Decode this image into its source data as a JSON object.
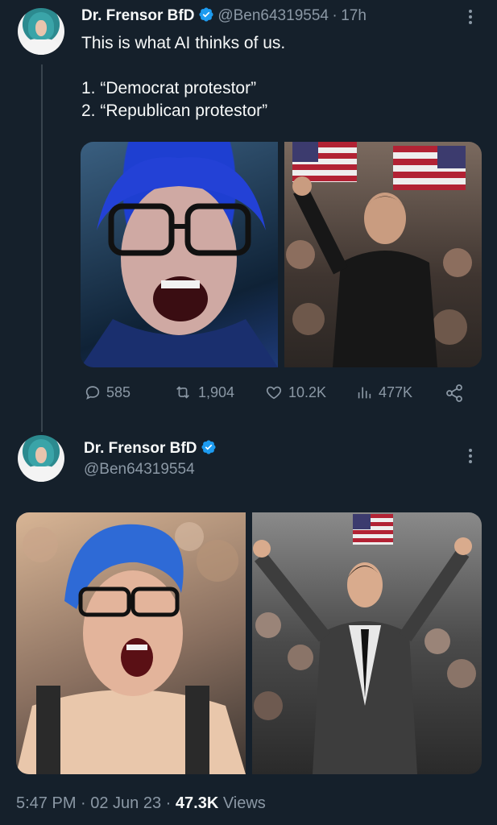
{
  "tweet1": {
    "author_name": "Dr. Frensor BfD",
    "handle": "@Ben64319554",
    "separator": "·",
    "time": "17h",
    "text_line1": "This is what AI thinks of us.",
    "text_line2": "1. “Democrat protestor”",
    "text_line3": "2. “Republican protestor”",
    "replies": "585",
    "retweets": "1,904",
    "likes": "10.2K",
    "views": "477K"
  },
  "tweet2": {
    "author_name": "Dr. Frensor BfD",
    "handle": "@Ben64319554",
    "timestamp": "5:47 PM · 02 Jun 23 · ",
    "views_count": "47.3K",
    "views_label": " Views"
  },
  "colors": {
    "background": "#15202b",
    "text": "#f7f9f9",
    "muted": "#8b98a5",
    "verified": "#1d9bf0"
  }
}
